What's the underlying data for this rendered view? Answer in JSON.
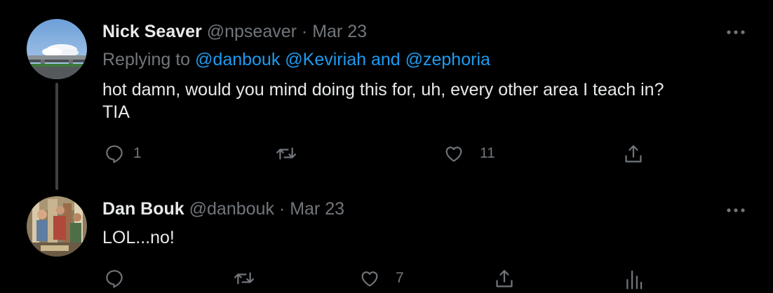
{
  "tweets": [
    {
      "display_name": "Nick Seaver",
      "handle": "@npseaver",
      "separator": "·",
      "date": "Mar 23",
      "replying_prefix": "Replying to",
      "mentions": [
        "@danbouk",
        "@Keviriah",
        "@zephoria"
      ],
      "mention_joiner": "and",
      "text_lines": [
        "hot damn, would you mind doing this for, uh, every other area I teach in?",
        "TIA"
      ],
      "reply_count": "1",
      "retweet_count": "",
      "like_count": "11"
    },
    {
      "display_name": "Dan Bouk",
      "handle": "@danbouk",
      "separator": "·",
      "date": "Mar 23",
      "text_lines": [
        "LOL...no!"
      ],
      "reply_count": "",
      "retweet_count": "",
      "like_count": "7"
    }
  ],
  "icons": {
    "reply": "reply-icon",
    "retweet": "retweet-icon",
    "like": "heart-icon",
    "share": "share-icon",
    "analytics": "analytics-icon",
    "more": "more-icon"
  },
  "colors": {
    "background": "#000000",
    "primary_text": "#e7e9ea",
    "secondary_text": "#71767b",
    "link": "#1d9bf0",
    "thread_line": "#3e4144"
  }
}
